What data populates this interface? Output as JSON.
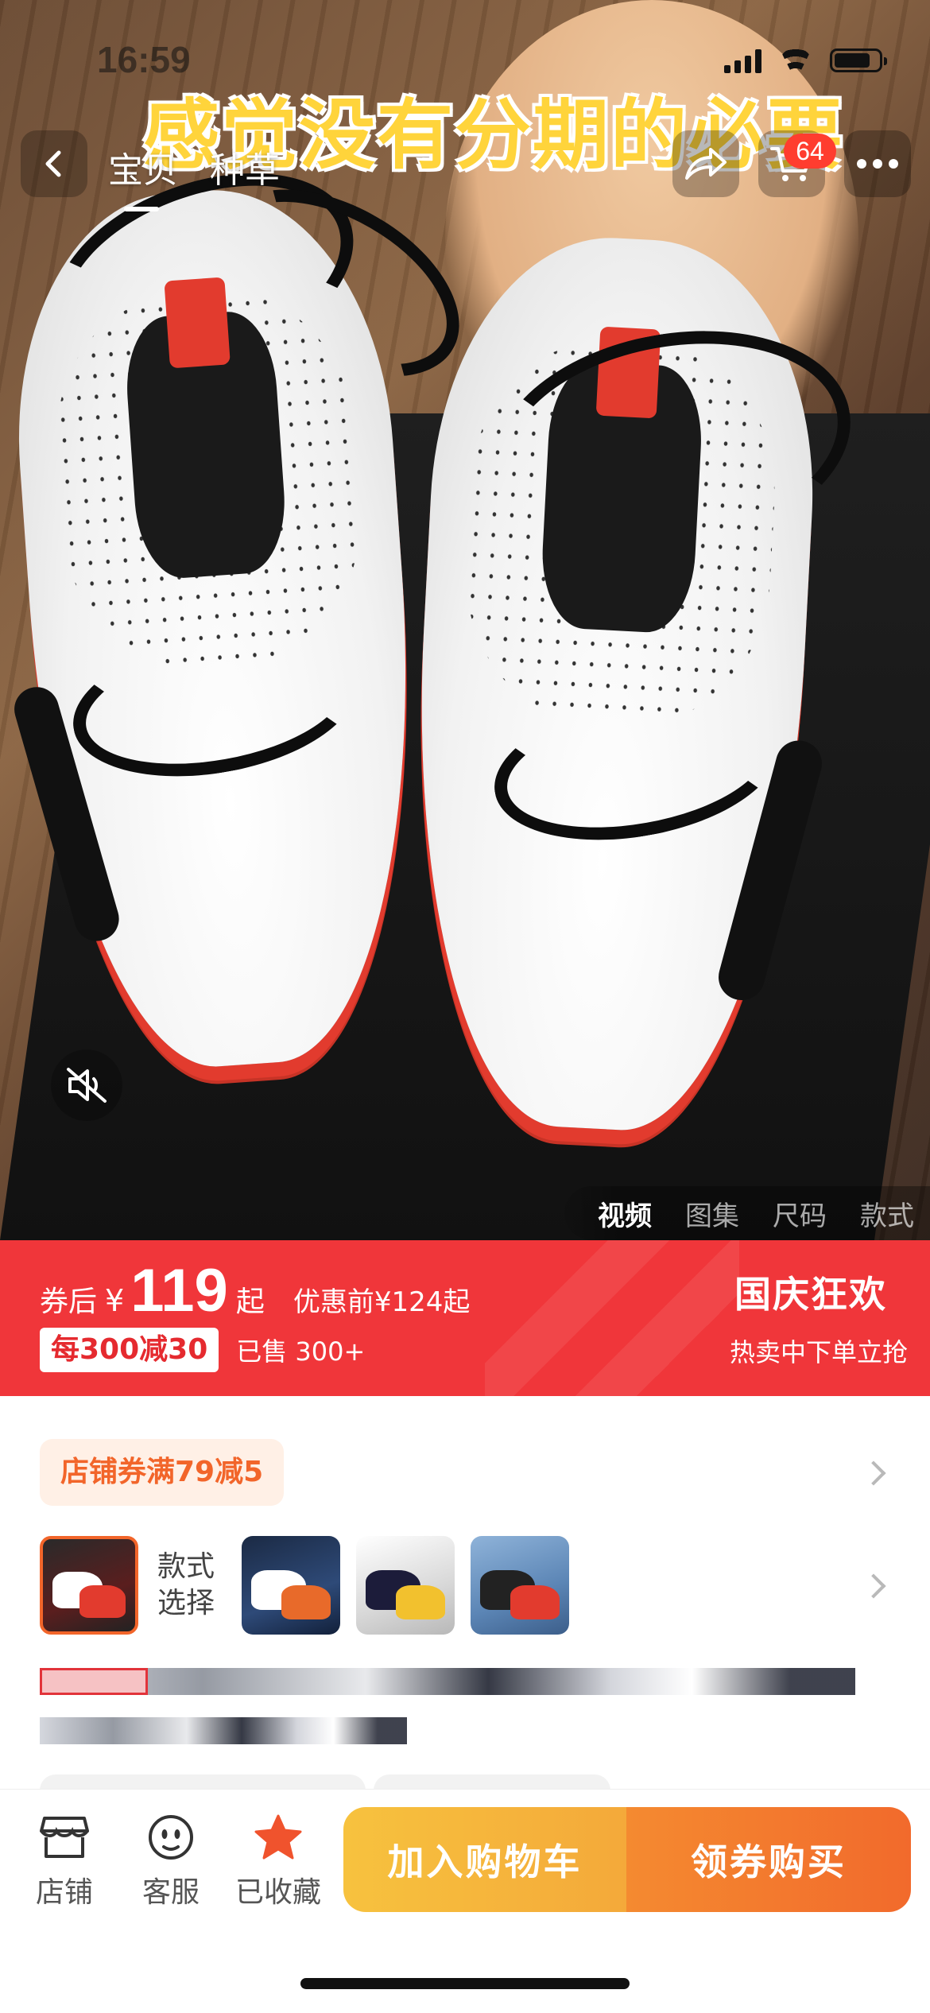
{
  "status_bar": {
    "time": "16:59"
  },
  "hero": {
    "caption": "感觉没有分期的必要",
    "nav_tabs": [
      "宝贝",
      "种草"
    ],
    "cart_badge": "64",
    "media_tabs": [
      "视频",
      "图集",
      "尺码",
      "款式"
    ]
  },
  "price_banner": {
    "after_coupon_label": "券后",
    "currency": "¥",
    "price": "119",
    "from_suffix": "起",
    "before_discount": "优惠前¥124起",
    "promo_tag": "每300减30",
    "sold": "已售 300+",
    "festival_title": "国庆狂欢",
    "festival_sub": "热卖中下单立抢",
    "colors": {
      "banner": "#f0363a"
    }
  },
  "details": {
    "store_coupon": "店铺券满79减5",
    "variant_label": "款式选择"
  },
  "bottom_bar": {
    "store": "店铺",
    "service": "客服",
    "favorited": "已收藏",
    "add_to_cart": "加入购物车",
    "buy_with_coupon": "领券购买",
    "colors": {
      "cart": "#f7c23e",
      "buy": "#f26a2c",
      "fav_star": "#f0532d"
    }
  },
  "icons": [
    "back-icon",
    "share-icon",
    "cart-icon",
    "more-icon",
    "mute-icon",
    "store-icon",
    "service-icon",
    "star-icon"
  ]
}
